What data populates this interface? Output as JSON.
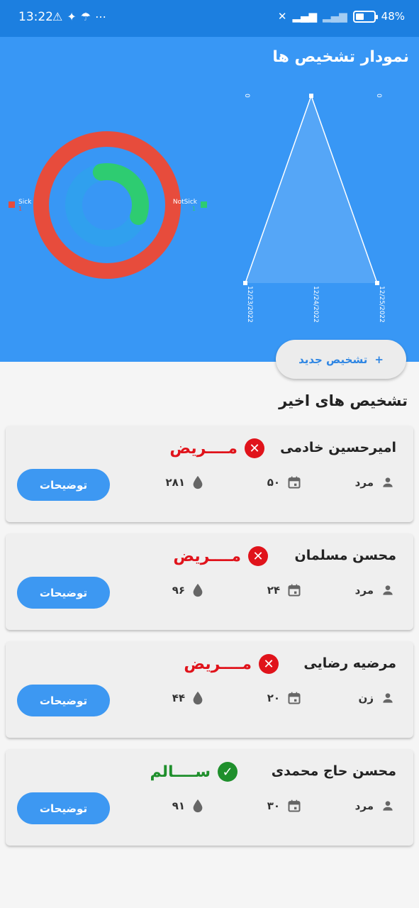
{
  "status_bar": {
    "time": "13:22",
    "left_icons": [
      "warning-icon",
      "twitter-icon",
      "notification-icon",
      "more-icon"
    ],
    "battery_text": "48%",
    "battery_level": 0.48
  },
  "header": {
    "title": "نمودار تشخیص ها",
    "new_button_label": "تشخیص جدید",
    "new_button_icon": "+"
  },
  "donut_chart": {
    "type": "pie",
    "series": [
      {
        "name": "Sick",
        "color": "#e74c3c",
        "value": 1
      },
      {
        "name": "NotSick",
        "color": "#2ecc71",
        "value": 1
      }
    ]
  },
  "chart_data": {
    "type": "area",
    "x": [
      "12/23/2022",
      "12/24/2022",
      "12/25/2022"
    ],
    "values": [
      0,
      1,
      0
    ],
    "top_labels": [
      "0",
      "0"
    ],
    "fill_color": "#5aa8f7",
    "line_color": "#ffffff"
  },
  "recent": {
    "title": "تشخیص های اخیر",
    "items": [
      {
        "name": "امیرحسین خادمی",
        "status": "مــــریض",
        "healthy": false,
        "gender": "مرد",
        "age": "۵۰",
        "sugar": "۲۸۱",
        "button": "توضیحات"
      },
      {
        "name": "محسن مسلمان",
        "status": "مــــریض",
        "healthy": false,
        "gender": "مرد",
        "age": "۲۴",
        "sugar": "۹۶",
        "button": "توضیحات"
      },
      {
        "name": "مرضیه رضایی",
        "status": "مــــریض",
        "healthy": false,
        "gender": "زن",
        "age": "۲۰",
        "sugar": "۴۴",
        "button": "توضیحات"
      },
      {
        "name": "محسن حاج محمدی",
        "status": "ســــالم",
        "healthy": true,
        "gender": "مرد",
        "age": "۳۰",
        "sugar": "۹۱",
        "button": "توضیحات"
      }
    ]
  },
  "colors": {
    "sick": "#e0131b",
    "healthy": "#1f8f2c",
    "primary": "#3897f5"
  }
}
